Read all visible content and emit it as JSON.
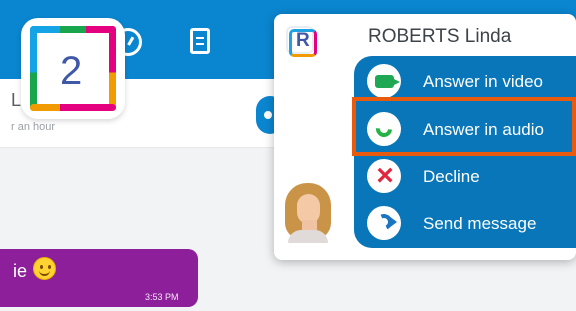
{
  "colors": {
    "primary_blue": "#0a86d0",
    "popup_blue": "#0876b9",
    "chat_bubble": "#8e1f9a",
    "highlight": "#e85a0d",
    "answer_green": "#25b346",
    "decline_red": "#e3263f"
  },
  "app": {
    "notification_count": "2"
  },
  "conversation": {
    "contact_name_partial": "L",
    "status_partial": "r an hour",
    "message_partial": "ie",
    "message_time": "3:53 PM"
  },
  "incoming_call": {
    "logo_letter": "R",
    "caller_name": "ROBERTS Linda",
    "actions": [
      {
        "label": "Answer in video",
        "icon": "video-call-icon"
      },
      {
        "label": "Answer in audio",
        "icon": "phone-answer-icon"
      },
      {
        "label": "Decline",
        "icon": "decline-x-icon"
      },
      {
        "label": "Send message",
        "icon": "send-message-icon"
      }
    ]
  }
}
